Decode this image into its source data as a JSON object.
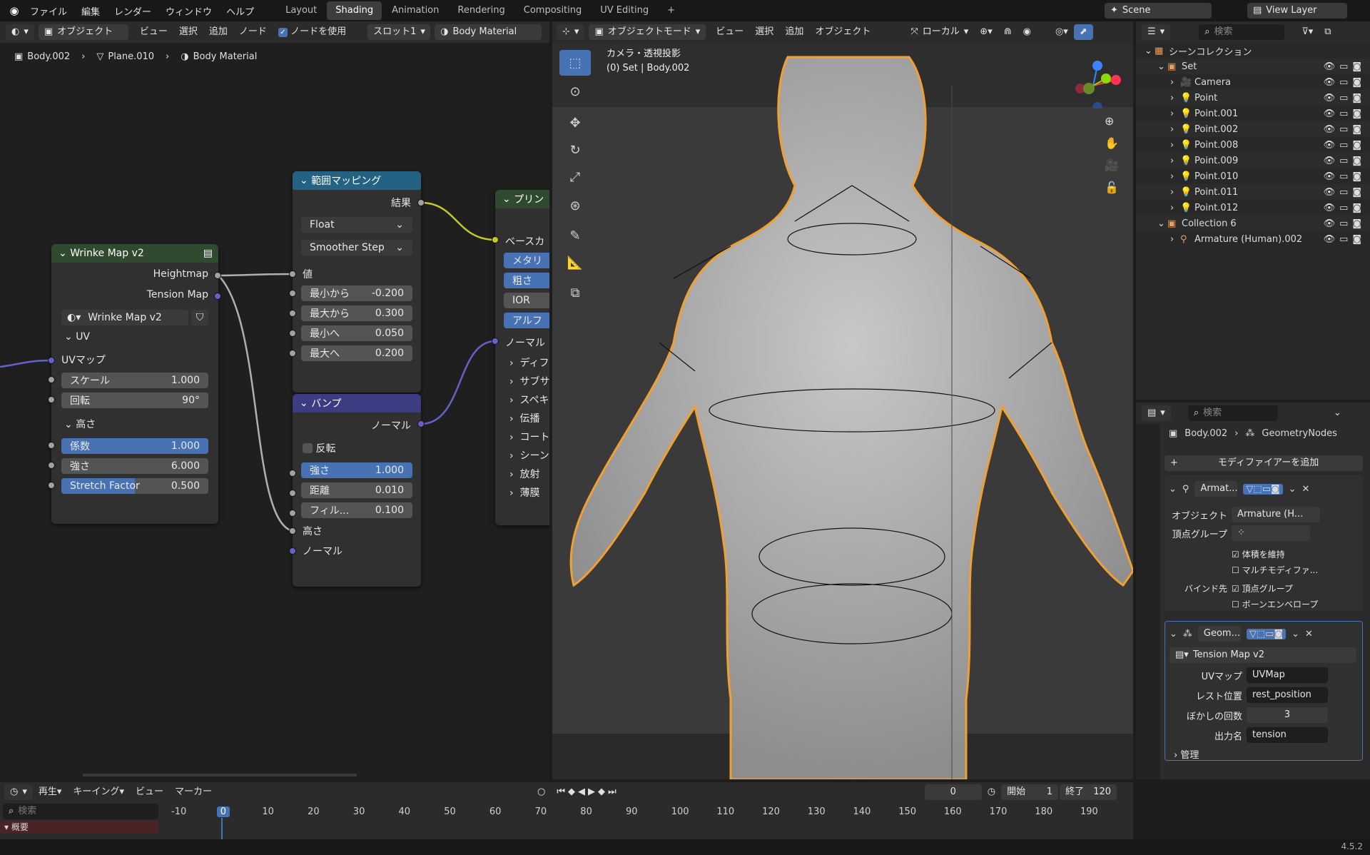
{
  "menu": [
    "ファイル",
    "編集",
    "レンダー",
    "ウィンドウ",
    "ヘルプ"
  ],
  "workspaces": [
    "Layout",
    "Shading",
    "Animation",
    "Rendering",
    "Compositing",
    "UV Editing"
  ],
  "active_workspace": "Shading",
  "scene": "Scene",
  "view_layer": "View Layer",
  "node_header": {
    "mode": "オブジェクト",
    "items": [
      "ビュー",
      "選択",
      "追加",
      "ノード"
    ],
    "use_nodes": "ノードを使用",
    "slot": "スロット1",
    "material": "Body Material"
  },
  "breadcrumb": [
    "Body.002",
    "Plane.010",
    "Body Material"
  ],
  "wrinkle": {
    "title": "Wrinke Map v2",
    "out1": "Heightmap",
    "out2": "Tension Map",
    "group": "Wrinke Map v2",
    "uv_section": "UV",
    "uv_map": "UVマップ",
    "scale_l": "スケール",
    "scale_v": "1.000",
    "rot_l": "回転",
    "rot_v": "90°",
    "h_section": "高さ",
    "fac_l": "係数",
    "fac_v": "1.000",
    "str_l": "強さ",
    "str_v": "6.000",
    "sf_l": "Stretch Factor",
    "sf_v": "0.500"
  },
  "maprange": {
    "title": "範囲マッピング",
    "out": "結果",
    "type": "Float",
    "interp": "Smoother Step",
    "val": "値",
    "a_l": "最小から",
    "a_v": "-0.200",
    "b_l": "最大から",
    "b_v": "0.300",
    "c_l": "最小へ",
    "c_v": "0.050",
    "d_l": "最大へ",
    "d_v": "0.200"
  },
  "bump": {
    "title": "バンプ",
    "out": "ノーマル",
    "invert": "反転",
    "str_l": "強さ",
    "str_v": "1.000",
    "dist_l": "距離",
    "dist_v": "0.010",
    "fil_l": "フィル...",
    "fil_v": "0.100",
    "h": "高さ",
    "n": "ノーマル"
  },
  "principled": {
    "title": "プリン",
    "base": "ベースカ",
    "metal": "メタリ",
    "rough": "粗さ",
    "ior": "IOR",
    "alpha": "アルフ",
    "normal": "ノーマル",
    "sections": [
      "ディフ",
      "サブサ",
      "スペキ",
      "伝播",
      "コート",
      "シーン",
      "放射",
      "薄膜"
    ]
  },
  "viewport": {
    "mode": "オブジェクトモード",
    "items": [
      "ビュー",
      "選択",
      "追加",
      "オブジェクト"
    ],
    "orient": "ローカル",
    "cam": "カメラ・透視投影",
    "obj": "(0) Set | Body.002"
  },
  "outliner": {
    "search": "検索",
    "rows": [
      {
        "name": "シーンコレクション",
        "d": 0
      },
      {
        "name": "Set",
        "d": 1
      },
      {
        "name": "Camera",
        "d": 2
      },
      {
        "name": "Point",
        "d": 2
      },
      {
        "name": "Point.001",
        "d": 2
      },
      {
        "name": "Point.002",
        "d": 2
      },
      {
        "name": "Point.008",
        "d": 2
      },
      {
        "name": "Point.009",
        "d": 2
      },
      {
        "name": "Point.010",
        "d": 2
      },
      {
        "name": "Point.011",
        "d": 2
      },
      {
        "name": "Point.012",
        "d": 2
      },
      {
        "name": "Collection 6",
        "d": 1
      },
      {
        "name": "Armature (Human).002",
        "d": 2
      }
    ]
  },
  "props": {
    "search": "検索",
    "obj": "Body.002",
    "geom": "GeometryNodes",
    "add": "モディファイアーを追加",
    "arm": {
      "name": "Armat...",
      "obj_l": "オブジェクト",
      "obj_v": "Armature (H...",
      "vg_l": "頂点グループ",
      "keep": "体積を維持",
      "multi": "マルチモディファ...",
      "bind": "バインド先",
      "vgroup": "頂点グループ",
      "env": "ボーンエンベロープ"
    },
    "geo": {
      "name": "Geom...",
      "tree": "Tension Map v2",
      "uv_l": "UVマップ",
      "uv_v": "UVMap",
      "rest_l": "レスト位置",
      "rest_v": "rest_position",
      "blur_l": "ぼかしの回数",
      "blur_v": "3",
      "out_l": "出力名",
      "out_v": "tension",
      "manage": "管理"
    }
  },
  "timeline": {
    "play": "再生",
    "key": "キーイング",
    "view": "ビュー",
    "marker": "マーカー",
    "frame": "0",
    "start_l": "開始",
    "start": "1",
    "end_l": "終了",
    "end": "120",
    "search": "検索",
    "summary": "概要",
    "nums": [
      "-10",
      "0",
      "10",
      "20",
      "30",
      "40",
      "50",
      "60",
      "70",
      "80",
      "90",
      "100",
      "110",
      "120",
      "130",
      "140",
      "150",
      "160",
      "170",
      "180",
      "190"
    ]
  },
  "version": "4.5.2"
}
